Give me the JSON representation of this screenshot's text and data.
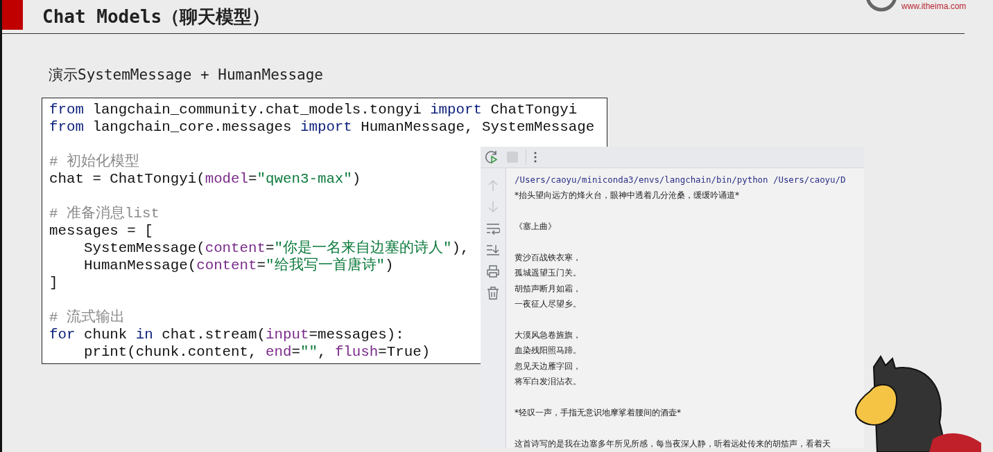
{
  "slide": {
    "title": "Chat Models（聊天模型）",
    "brand_url": "www.itheima.com",
    "subtitle": "演示SystemMessage + HumanMessage"
  },
  "code": [
    {
      "kind": "code",
      "tokens": [
        {
          "kind": "keyword",
          "text": "from"
        },
        {
          "kind": "plain",
          "text": " langchain_community.chat_models.tongyi "
        },
        {
          "kind": "keyword",
          "text": "import"
        },
        {
          "kind": "plain",
          "text": " ChatTongyi"
        }
      ]
    },
    {
      "kind": "code",
      "tokens": [
        {
          "kind": "keyword",
          "text": "from"
        },
        {
          "kind": "plain",
          "text": " langchain_core.messages "
        },
        {
          "kind": "keyword",
          "text": "import"
        },
        {
          "kind": "plain",
          "text": " HumanMessage, SystemMessage"
        }
      ]
    },
    {
      "kind": "blank"
    },
    {
      "kind": "code",
      "tokens": [
        {
          "kind": "comment",
          "text": "# 初始化模型"
        }
      ]
    },
    {
      "kind": "code",
      "tokens": [
        {
          "kind": "plain",
          "text": "chat = ChatTongyi("
        },
        {
          "kind": "param",
          "text": "model"
        },
        {
          "kind": "plain",
          "text": "="
        },
        {
          "kind": "string",
          "text": "\"qwen3-max\""
        },
        {
          "kind": "plain",
          "text": ")"
        }
      ]
    },
    {
      "kind": "blank"
    },
    {
      "kind": "code",
      "tokens": [
        {
          "kind": "comment",
          "text": "# 准备消息list"
        }
      ]
    },
    {
      "kind": "code",
      "tokens": [
        {
          "kind": "plain",
          "text": "messages = ["
        }
      ]
    },
    {
      "kind": "code",
      "tokens": [
        {
          "kind": "plain",
          "text": "    SystemMessage("
        },
        {
          "kind": "param",
          "text": "content"
        },
        {
          "kind": "plain",
          "text": "="
        },
        {
          "kind": "string",
          "text": "\"你是一名来自边塞的诗人\""
        },
        {
          "kind": "plain",
          "text": "),"
        }
      ]
    },
    {
      "kind": "code",
      "tokens": [
        {
          "kind": "plain",
          "text": "    HumanMessage("
        },
        {
          "kind": "param",
          "text": "content"
        },
        {
          "kind": "plain",
          "text": "="
        },
        {
          "kind": "string",
          "text": "\"给我写一首唐诗\""
        },
        {
          "kind": "plain",
          "text": ")"
        }
      ]
    },
    {
      "kind": "code",
      "tokens": [
        {
          "kind": "plain",
          "text": "]"
        }
      ]
    },
    {
      "kind": "blank"
    },
    {
      "kind": "code",
      "tokens": [
        {
          "kind": "comment",
          "text": "# 流式输出"
        }
      ]
    },
    {
      "kind": "code",
      "tokens": [
        {
          "kind": "keyword",
          "text": "for"
        },
        {
          "kind": "plain",
          "text": " chunk "
        },
        {
          "kind": "keyword",
          "text": "in"
        },
        {
          "kind": "plain",
          "text": " chat.stream("
        },
        {
          "kind": "param",
          "text": "input"
        },
        {
          "kind": "plain",
          "text": "=messages):"
        }
      ]
    },
    {
      "kind": "code",
      "tokens": [
        {
          "kind": "plain",
          "text": "    print(chunk.content, "
        },
        {
          "kind": "param",
          "text": "end"
        },
        {
          "kind": "plain",
          "text": "="
        },
        {
          "kind": "string",
          "text": "\"\""
        },
        {
          "kind": "plain",
          "text": ", "
        },
        {
          "kind": "param",
          "text": "flush"
        },
        {
          "kind": "plain",
          "text": "=True)"
        }
      ]
    }
  ],
  "console": {
    "output": [
      {
        "kind": "command",
        "text": "/Users/caoyu/miniconda3/envs/langchain/bin/python /Users/caoyu/D"
      },
      {
        "kind": "text",
        "text": "*抬头望向远方的烽火台，眼神中透着几分沧桑，缓缓吟诵道*"
      },
      {
        "kind": "blank"
      },
      {
        "kind": "text",
        "text": "《塞上曲》"
      },
      {
        "kind": "blank"
      },
      {
        "kind": "text",
        "text": "黄沙百战铁衣寒，"
      },
      {
        "kind": "text",
        "text": "孤城遥望玉门关。"
      },
      {
        "kind": "text",
        "text": "胡笳声断月如霜，"
      },
      {
        "kind": "text",
        "text": "一夜征人尽望乡。"
      },
      {
        "kind": "blank"
      },
      {
        "kind": "text",
        "text": "大漠风急卷旌旗，"
      },
      {
        "kind": "text",
        "text": "血染残阳照马蹄。"
      },
      {
        "kind": "text",
        "text": "忽见天边雁字回，"
      },
      {
        "kind": "text",
        "text": "将军白发泪沾衣。"
      },
      {
        "kind": "blank"
      },
      {
        "kind": "text",
        "text": "*轻叹一声，手指无意识地摩挲着腰间的酒壶*"
      },
      {
        "kind": "blank"
      },
      {
        "kind": "text",
        "text": "这首诗写的是我在边塞多年所见所感，每当夜深人静，听着远处传来的胡笳声，看着天"
      }
    ]
  }
}
